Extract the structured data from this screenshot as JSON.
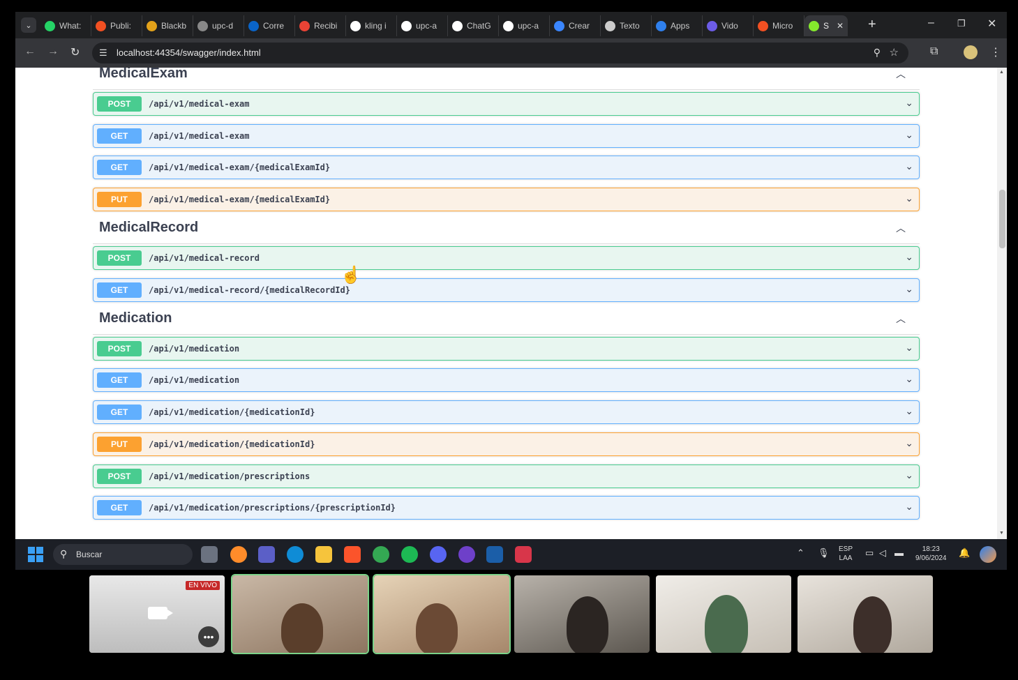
{
  "browser": {
    "tabs": [
      {
        "label": "What:",
        "icon": "whatsapp-icon",
        "color": "#25d366"
      },
      {
        "label": "Publi:",
        "icon": "microsoft-icon",
        "color": "#f25022"
      },
      {
        "label": "Blackb",
        "icon": "blackboard-icon",
        "color": "#e3a21a"
      },
      {
        "label": "upc-d",
        "icon": "globe-icon",
        "color": "#888888"
      },
      {
        "label": "Corre",
        "icon": "outlook-icon",
        "color": "#0a64c8"
      },
      {
        "label": "Recibi",
        "icon": "gmail-icon",
        "color": "#ea4335"
      },
      {
        "label": "kling i",
        "icon": "google-icon",
        "color": "#ffffff"
      },
      {
        "label": "upc-a",
        "icon": "github-icon",
        "color": "#ffffff"
      },
      {
        "label": "ChatG",
        "icon": "chatgpt-icon",
        "color": "#ffffff"
      },
      {
        "label": "upc-a",
        "icon": "github-icon",
        "color": "#ffffff"
      },
      {
        "label": "Crear",
        "icon": "azure-icon",
        "color": "#3a86ff"
      },
      {
        "label": "Texto",
        "icon": "globe-icon",
        "color": "#cccccc"
      },
      {
        "label": "Apps",
        "icon": "copilot-icon",
        "color": "#2f80ed"
      },
      {
        "label": "Vido",
        "icon": "video-icon",
        "color": "#6c5ce7"
      },
      {
        "label": "Micro",
        "icon": "microsoft-icon",
        "color": "#f25022"
      },
      {
        "label": "S",
        "icon": "swagger-icon",
        "color": "#85ea2d",
        "active": true
      }
    ],
    "url": "localhost:44354/swagger/index.html"
  },
  "swagger": {
    "sections": [
      {
        "title": "MedicalExam",
        "operations": [
          {
            "method": "POST",
            "path": "/api/v1/medical-exam"
          },
          {
            "method": "GET",
            "path": "/api/v1/medical-exam"
          },
          {
            "method": "GET",
            "path": "/api/v1/medical-exam/{medicalExamId}"
          },
          {
            "method": "PUT",
            "path": "/api/v1/medical-exam/{medicalExamId}"
          }
        ]
      },
      {
        "title": "MedicalRecord",
        "operations": [
          {
            "method": "POST",
            "path": "/api/v1/medical-record"
          },
          {
            "method": "GET",
            "path": "/api/v1/medical-record/{medicalRecordId}"
          }
        ]
      },
      {
        "title": "Medication",
        "operations": [
          {
            "method": "POST",
            "path": "/api/v1/medication"
          },
          {
            "method": "GET",
            "path": "/api/v1/medication"
          },
          {
            "method": "GET",
            "path": "/api/v1/medication/{medicationId}"
          },
          {
            "method": "PUT",
            "path": "/api/v1/medication/{medicationId}"
          },
          {
            "method": "POST",
            "path": "/api/v1/medication/prescriptions"
          },
          {
            "method": "GET",
            "path": "/api/v1/medication/prescriptions/{prescriptionId}"
          }
        ]
      }
    ],
    "colors": {
      "post": "#49cc90",
      "get": "#61affe",
      "put": "#fca130"
    }
  },
  "taskbar": {
    "search_placeholder": "Buscar",
    "lang_line1": "ESP",
    "lang_line2": "LAA",
    "time": "18:23",
    "date": "9/06/2024"
  },
  "meeting": {
    "live_badge": "EN VIVO"
  }
}
